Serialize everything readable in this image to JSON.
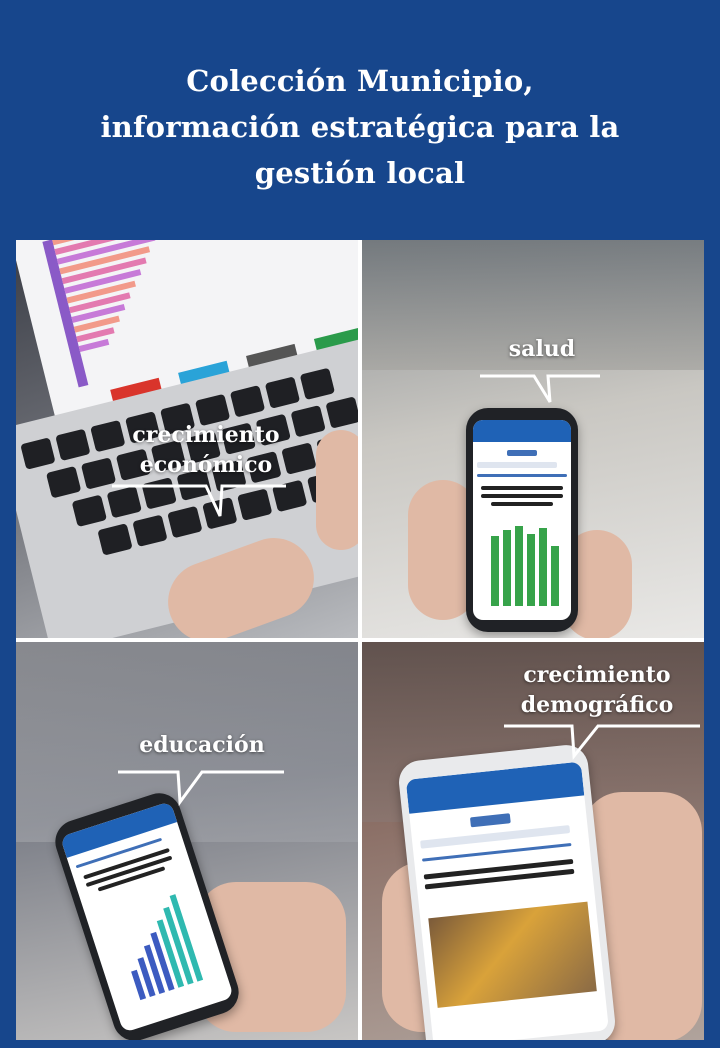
{
  "title": {
    "line1": "Colección Municipio,",
    "line2": "información estratégica para la",
    "line3": "gestión local"
  },
  "panels": {
    "economico": {
      "label_line1": "crecimiento",
      "label_line2": "económico"
    },
    "salud": {
      "label": "salud"
    },
    "educacion": {
      "label": "educación"
    },
    "demografico": {
      "label_line1": "crecimiento",
      "label_line2": "demográfico"
    }
  },
  "colors": {
    "background": "#17468c",
    "text": "#ffffff",
    "accent_phone": "#1f62b6",
    "chart_green": "#37a34a"
  }
}
